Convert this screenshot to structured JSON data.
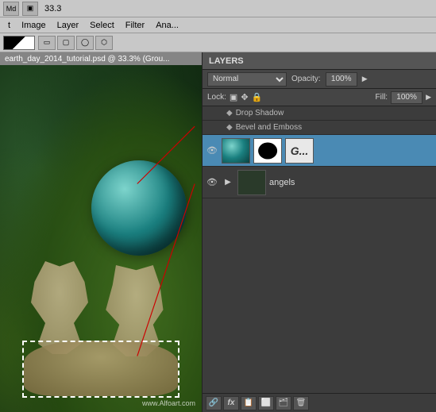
{
  "topbar": {
    "zoom": "33.3",
    "unit": "%"
  },
  "menubar": {
    "items": [
      "t",
      "Image",
      "Layer",
      "Select",
      "Filter",
      "Ana..."
    ]
  },
  "canvas": {
    "title": "earth_day_2014_tutorial.psd @ 33.3% (Grou...",
    "watermark": "www.Alfoart.com"
  },
  "layers": {
    "panel_title": "LAYERS",
    "blend_mode": "Normal",
    "opacity_label": "Opacity:",
    "opacity_value": "100%",
    "lock_label": "Lock:",
    "fill_label": "Fill:",
    "fill_value": "100%",
    "items": [
      {
        "name": "Drop Shadow",
        "type": "fx",
        "icon": "◆"
      },
      {
        "name": "Bevel and Emboss",
        "type": "fx",
        "icon": "◆"
      },
      {
        "name": "(sphere layer)",
        "type": "layer",
        "active": true,
        "has_mask": true
      },
      {
        "name": "angels",
        "type": "group",
        "active": false
      }
    ]
  },
  "panel_bottom": {
    "buttons": [
      "🔗",
      "fx",
      "📋",
      "🎨",
      "🗂️",
      "🗑️"
    ]
  }
}
